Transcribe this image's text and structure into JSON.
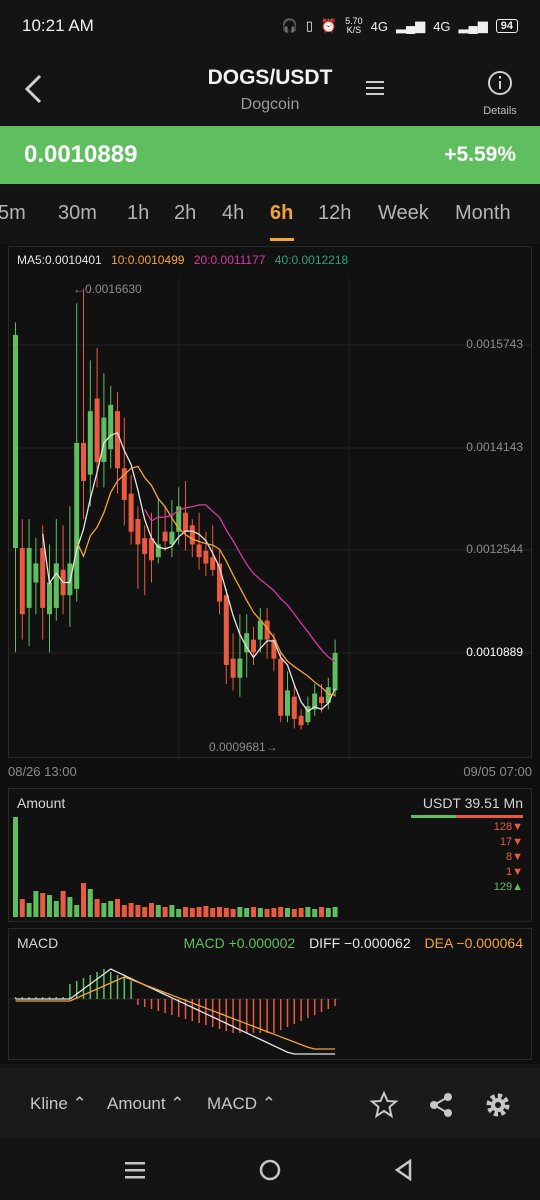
{
  "status": {
    "time": "10:21 AM",
    "speed_top": "5.70",
    "speed_bottom": "K/S",
    "net1": "4G",
    "net2": "4G",
    "battery": "94"
  },
  "header": {
    "pair": "DOGS/USDT",
    "name": "Dogcoin",
    "details_label": "Details"
  },
  "ticker": {
    "price": "0.0010889",
    "change": "+5.59%",
    "color": "#5fbf5f"
  },
  "tabs": [
    "5m",
    "30m",
    "1h",
    "2h",
    "4h",
    "6h",
    "12h",
    "Week",
    "Month"
  ],
  "active_tab": "6h",
  "main_chart": {
    "ma": {
      "ma5": "MA5:0.0010401",
      "ma10": "10:0.0010499",
      "ma20": "20:0.0011177",
      "ma40": "40:0.0012218"
    },
    "price_labels": [
      "0.0015743",
      "0.0014143",
      "0.0012544",
      "0.0010889"
    ],
    "high_label": "←0.0016630",
    "low_label": "0.0009681→",
    "start_date": "08/26 13:00",
    "end_date": "09/05 07:00"
  },
  "volume": {
    "title": "Amount",
    "summary": "USDT 39.51 Mn",
    "stats": [
      {
        "text": "128▼",
        "color": "#ea5a3f"
      },
      {
        "text": "17▼",
        "color": "#ea5a3f"
      },
      {
        "text": "8▼",
        "color": "#ea5a3f"
      },
      {
        "text": "1▼",
        "color": "#ea5a3f"
      },
      {
        "text": "129▲",
        "color": "#5fbf5f"
      }
    ]
  },
  "macd": {
    "title": "MACD",
    "macd_value": "MACD +0.000002",
    "diff_value": "DIFF −0.000062",
    "dea_value": "DEA −0.000064"
  },
  "colors": {
    "up": "#5fbf5f",
    "down": "#ea5a3f",
    "accent": "#f2a33c",
    "ma10": "#f2a33c",
    "ma20": "#d63aa4",
    "ma40": "#2fa07a"
  },
  "bottom_bar": {
    "kline": "Kline ⌃",
    "amount": "Amount ⌃",
    "macd": "MACD ⌃"
  },
  "chart_data": {
    "type": "candlestick",
    "pair": "DOGS/USDT",
    "interval": "6h",
    "y_ticks": [
      0.0015743,
      0.0014143,
      0.0012544,
      0.0010889
    ],
    "high": 0.001663,
    "low": 0.0009681,
    "last": 0.0010889
  }
}
